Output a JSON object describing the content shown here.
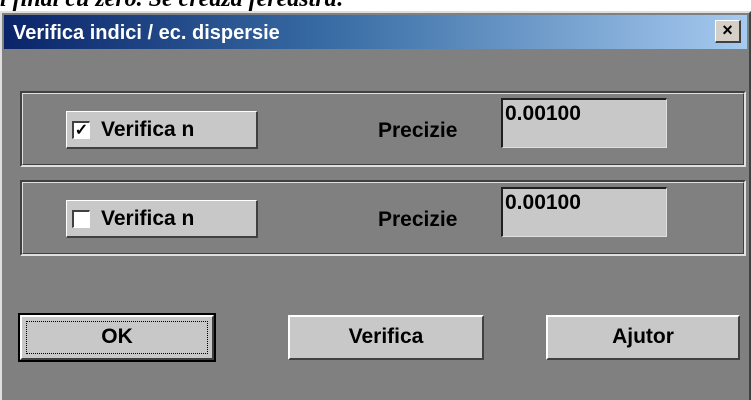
{
  "background_text": "l final cu zero. Se creaza fereastra:",
  "dialog": {
    "title": "Verifica indici / ec. dispersie",
    "close_glyph": "×"
  },
  "rows": [
    {
      "checkbox_label": "Verifica n",
      "checked": true,
      "check_glyph": "✓",
      "precision_label": "Precizie",
      "precision_value": "0.00100"
    },
    {
      "checkbox_label": "Verifica n",
      "checked": false,
      "check_glyph": "",
      "precision_label": "Precizie",
      "precision_value": "0.00100"
    }
  ],
  "buttons": {
    "ok": "OK",
    "verifica": "Verifica",
    "ajutor": "Ajutor"
  }
}
